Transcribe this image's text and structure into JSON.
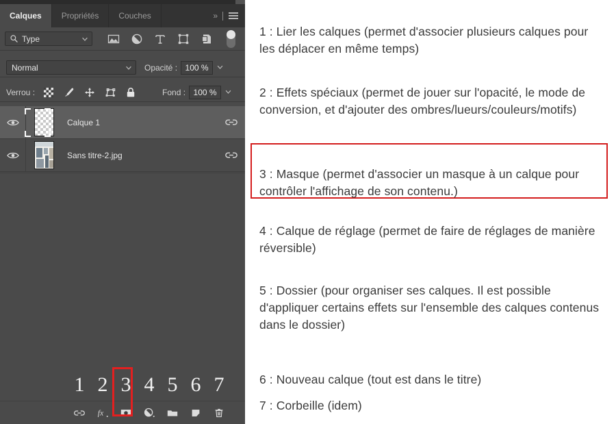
{
  "panel": {
    "tabs": [
      {
        "label": "Calques",
        "active": true
      },
      {
        "label": "Propriétés",
        "active": false
      },
      {
        "label": "Couches",
        "active": false
      }
    ],
    "tab_overflow_label": "»",
    "menu_icon": "hamburger-menu-icon",
    "filter": {
      "search_icon": "search-icon",
      "kind_label": "Type",
      "icons": [
        "image-filter-icon",
        "adjustment-filter-icon",
        "text-filter-icon",
        "shape-filter-icon",
        "smart-object-filter-icon"
      ],
      "toggle_name": "filter-enable-toggle"
    },
    "blend": {
      "mode_value": "Normal",
      "opacity_label": "Opacité :",
      "opacity_value": "100 %"
    },
    "lock": {
      "label": "Verrou :",
      "fill_label": "Fond :",
      "fill_value": "100 %",
      "icons": [
        "lock-transparency-icon",
        "lock-image-pixels-icon",
        "lock-position-icon",
        "lock-artboard-nesting-icon",
        "lock-all-icon"
      ]
    },
    "layers": [
      {
        "name": "Calque 1",
        "visible": true,
        "selected": true,
        "thumb": "transparent",
        "eye_icon": "eye-icon",
        "link_icon": "link-icon"
      },
      {
        "name": "Sans titre-2.jpg",
        "visible": true,
        "selected": false,
        "thumb": "image",
        "eye_icon": "eye-icon",
        "link_icon": "link-icon"
      }
    ],
    "callout_numbers": [
      "1",
      "2",
      "3",
      "4",
      "5",
      "6",
      "7"
    ],
    "highlighted_number": "3",
    "bottom_buttons": [
      {
        "number": "1",
        "icon": "link-layers-icon",
        "title": "Lier les calques"
      },
      {
        "number": "2",
        "icon": "layer-effects-fx-icon",
        "title": "Effets spéciaux"
      },
      {
        "number": "3",
        "icon": "layer-mask-icon",
        "title": "Masque",
        "highlighted": true
      },
      {
        "number": "4",
        "icon": "adjustment-layer-icon",
        "title": "Calque de réglage"
      },
      {
        "number": "5",
        "icon": "folder-icon",
        "title": "Dossier"
      },
      {
        "number": "6",
        "icon": "new-layer-icon",
        "title": "Nouveau calque"
      },
      {
        "number": "7",
        "icon": "trash-icon",
        "title": "Corbeille"
      }
    ]
  },
  "notes": [
    {
      "id": "note1",
      "text": "1 : Lier les calques (permet d'associer plusieurs calques pour les déplacer en même temps)"
    },
    {
      "id": "note2",
      "text": "2 : Effets spéciaux (permet de jouer sur l'opacité, le mode de conversion, et d'ajouter des ombres/lueurs/couleurs/motifs)"
    },
    {
      "id": "note3",
      "text": "3 : Masque (permet d'associer un masque à un calque pour contrôler l'affichage de son contenu.)",
      "highlighted": true
    },
    {
      "id": "note4",
      "text": "4 : Calque de réglage (permet de faire de réglages de manière réversible)"
    },
    {
      "id": "note5",
      "text": "5 : Dossier (pour organiser ses calques. Il est possible d'appliquer certains effets sur l'ensemble des calques contenus dans le dossier)"
    },
    {
      "id": "note6",
      "text": "6 : Nouveau calque (tout est dans le titre)"
    },
    {
      "id": "note7",
      "text": "7 : Corbeille (idem)"
    }
  ],
  "colors": {
    "panel_bg": "#4a4a4a",
    "tabbar_bg": "#333333",
    "selected_layer_bg": "#5e5e5e",
    "highlight_red": "#d41d1d",
    "text_light": "#e8e8e8",
    "notes_text": "#3a3a3a",
    "notes_bg": "#ffffff"
  }
}
